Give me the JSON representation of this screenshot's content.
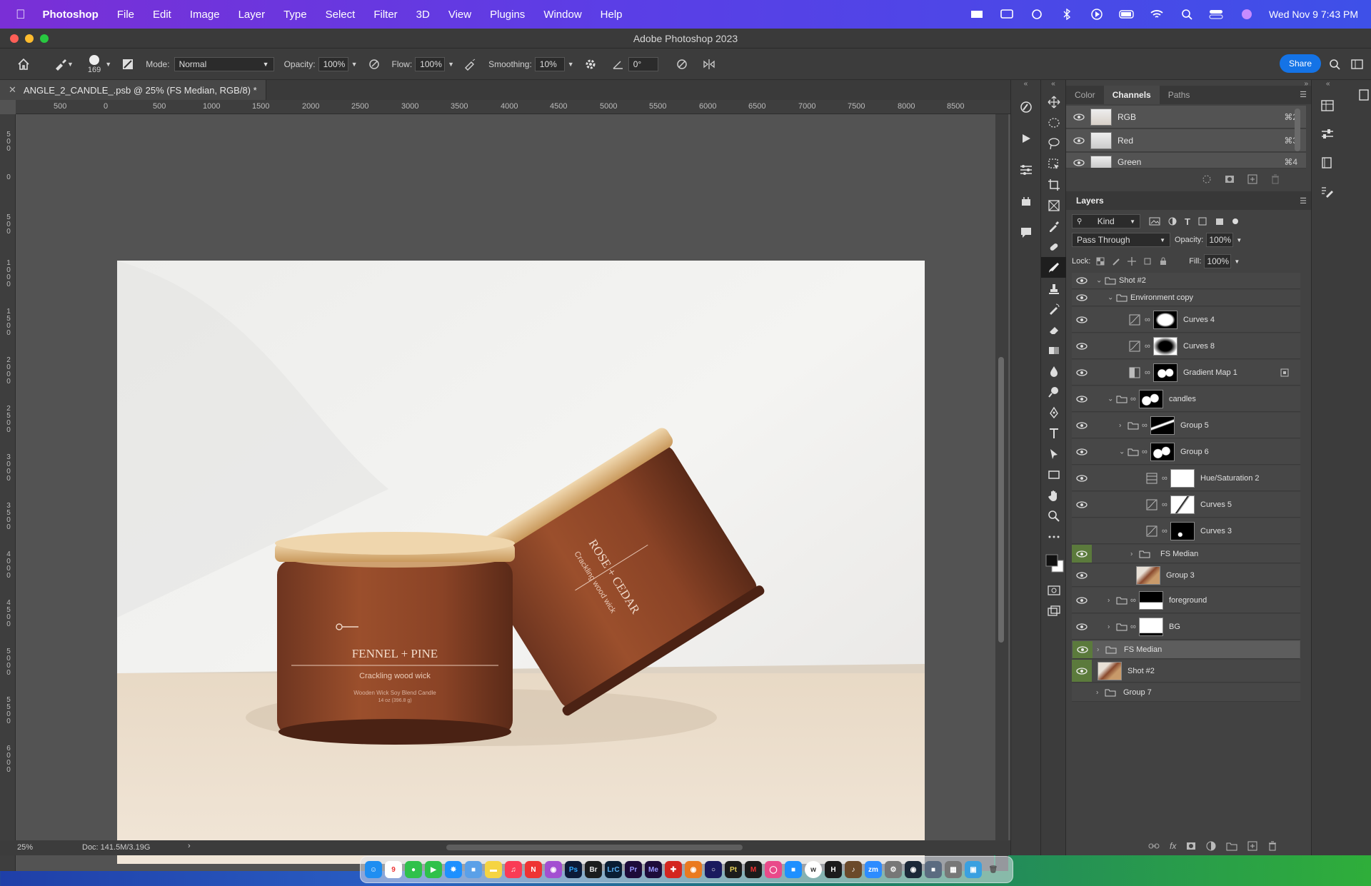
{
  "menubar": {
    "app": "Photoshop",
    "items": [
      "File",
      "Edit",
      "Image",
      "Layer",
      "Type",
      "Select",
      "Filter",
      "3D",
      "View",
      "Plugins",
      "Window",
      "Help"
    ],
    "clock": "Wed Nov 9  7:43 PM"
  },
  "window": {
    "title": "Adobe Photoshop 2023"
  },
  "options": {
    "brush_size": "169",
    "mode_label": "Mode:",
    "mode_value": "Normal",
    "opacity_label": "Opacity:",
    "opacity_value": "100%",
    "flow_label": "Flow:",
    "flow_value": "100%",
    "smoothing_label": "Smoothing:",
    "smoothing_value": "10%",
    "angle_value": "0°",
    "share_label": "Share"
  },
  "document": {
    "tab_title": "ANGLE_2_CANDLE_.psb @ 25% (FS Median, RGB/8) *",
    "zoom": "25%",
    "doc_info": "Doc: 141.5M/3.19G",
    "candle_left_title": "FENNEL + PINE",
    "candle_left_sub": "Crackling wood wick",
    "candle_left_fine": "Wooden Wick Soy Blend Candle",
    "candle_left_size": "14 oz (396.8 g)",
    "candle_right_title": "ROSE + CEDAR",
    "candle_right_sub": "Crackling wood wick"
  },
  "ruler_h": [
    "500",
    "0",
    "500",
    "1000",
    "1500",
    "2000",
    "2500",
    "3000",
    "3500",
    "4000",
    "4500",
    "5000",
    "5500",
    "6000",
    "6500",
    "7000",
    "7500",
    "8000",
    "8500"
  ],
  "ruler_v": [
    "500",
    "0",
    "500",
    "1000",
    "1500",
    "2000",
    "2500",
    "3000",
    "3500",
    "4000",
    "4500",
    "5000",
    "5500",
    "6000"
  ],
  "channels_panel": {
    "tabs": [
      "Color",
      "Channels",
      "Paths"
    ],
    "rows": [
      {
        "name": "RGB",
        "shortcut": "⌘2"
      },
      {
        "name": "Red",
        "shortcut": "⌘3"
      },
      {
        "name": "Green",
        "shortcut": "⌘4"
      }
    ]
  },
  "layers_panel": {
    "title": "Layers",
    "kind_label": "Kind",
    "blend_mode": "Pass Through",
    "opacity_label": "Opacity:",
    "opacity_value": "100%",
    "lock_label": "Lock:",
    "fill_label": "Fill:",
    "fill_value": "100%",
    "layers": [
      {
        "name": "Shot #2"
      },
      {
        "name": "Environment copy"
      },
      {
        "name": "Curves 4"
      },
      {
        "name": "Curves 8"
      },
      {
        "name": "Gradient Map 1"
      },
      {
        "name": "candles"
      },
      {
        "name": "Group 5"
      },
      {
        "name": "Group 6"
      },
      {
        "name": "Hue/Saturation 2"
      },
      {
        "name": "Curves 5"
      },
      {
        "name": "Curves 3"
      },
      {
        "name": "FS Median"
      },
      {
        "name": "Group 3"
      },
      {
        "name": "foreground"
      },
      {
        "name": "BG"
      },
      {
        "name": "FS Median"
      },
      {
        "name": "Shot #2"
      },
      {
        "name": "Group 7"
      }
    ]
  },
  "colors": {
    "accent": "#1473e6",
    "menubar_start": "#7a2fd6",
    "visible_green": "#5b7a3c"
  }
}
